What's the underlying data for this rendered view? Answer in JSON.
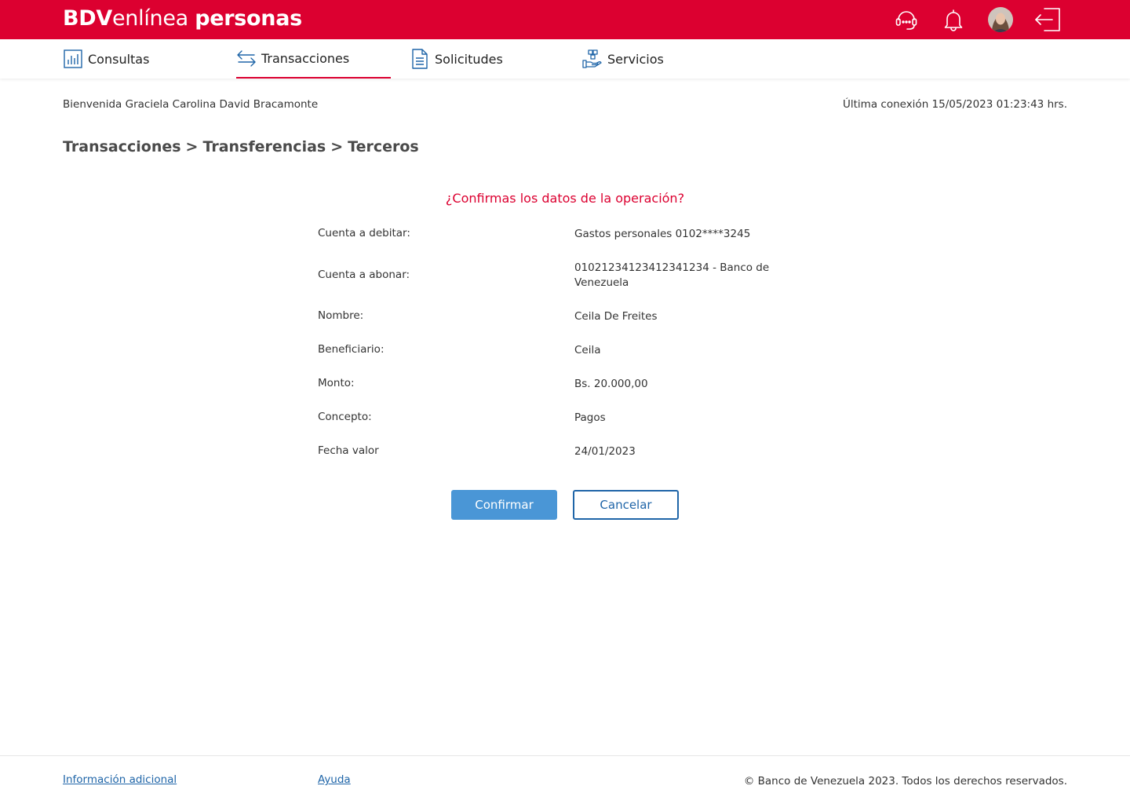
{
  "brand": {
    "logo_bold": "BDV",
    "logo_light": "enlínea",
    "logo_tail": "personas",
    "primary_color": "#dc0030",
    "accent_blue": "#1f65a8"
  },
  "header_icons": [
    "headset-icon",
    "bell-icon",
    "avatar",
    "logout-icon"
  ],
  "nav": {
    "consultas": "Consultas",
    "transacciones": "Transacciones",
    "solicitudes": "Solicitudes",
    "servicios": "Servicios",
    "active": "Transacciones"
  },
  "welcome": "Bienvenida Graciela Carolina David Bracamonte",
  "last_connection": "Última conexión 15/05/2023 01:23:43 hrs.",
  "breadcrumb": {
    "l1": "Transacciones",
    "sep1": ">",
    "l2": "Transferencias",
    "sep2": ">",
    "l3": "Terceros"
  },
  "confirm": {
    "question": "¿Confirmas los datos de la operación?",
    "rows": [
      {
        "label": "Cuenta a debitar:",
        "value": "Gastos personales 0102****3245"
      },
      {
        "label": "Cuenta a abonar:",
        "value": "01021234123412341234 - Banco de Venezuela"
      },
      {
        "label": "Nombre:",
        "value": "Ceila De Freites"
      },
      {
        "label": "Beneficiario:",
        "value": "Ceila"
      },
      {
        "label": "Monto:",
        "value": "Bs. 20.000,00"
      },
      {
        "label": "Concepto:",
        "value": "Pagos"
      },
      {
        "label": "Fecha valor",
        "value": "24/01/2023"
      }
    ],
    "confirm_label": "Confirmar",
    "cancel_label": "Cancelar"
  },
  "footer": {
    "info": "Información adicional",
    "help": "Ayuda",
    "copyright": "© Banco de Venezuela 2023. Todos los derechos reservados."
  }
}
